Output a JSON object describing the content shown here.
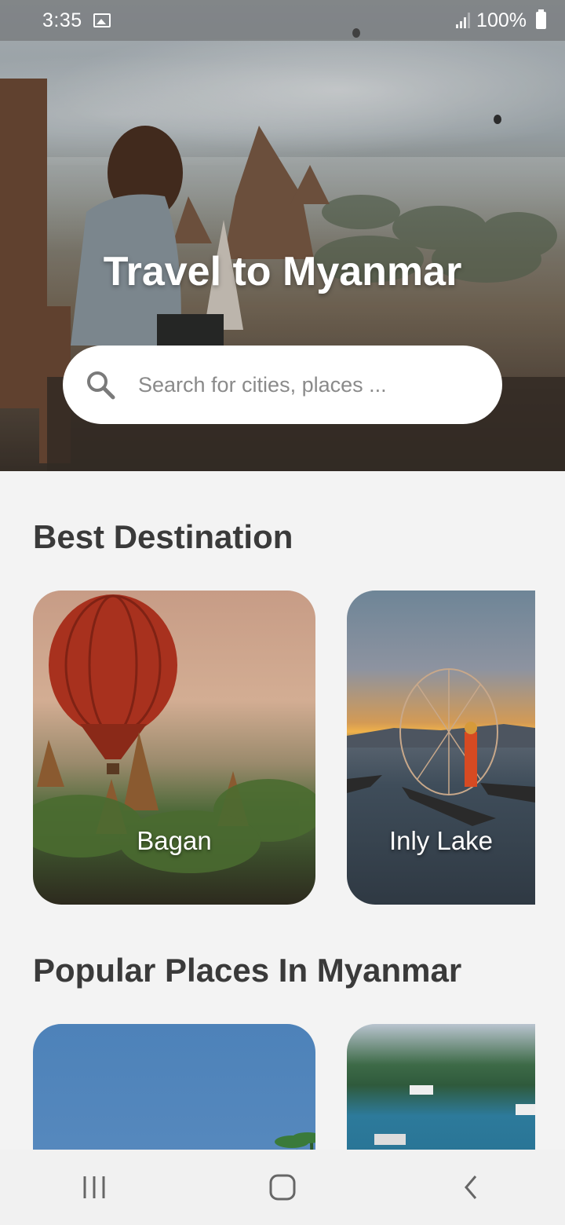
{
  "status_bar": {
    "time": "3:35",
    "battery": "100%"
  },
  "hero": {
    "title": "Travel to Myanmar",
    "search_placeholder": "Search for cities, places ..."
  },
  "best_destination": {
    "title": "Best Destination",
    "cards": [
      {
        "label": "Bagan"
      },
      {
        "label": "Inly Lake"
      }
    ]
  },
  "popular_places": {
    "title": "Popular Places In Myanmar"
  },
  "nav": {
    "icons": [
      "recent-apps-icon",
      "home-icon",
      "back-icon"
    ]
  }
}
